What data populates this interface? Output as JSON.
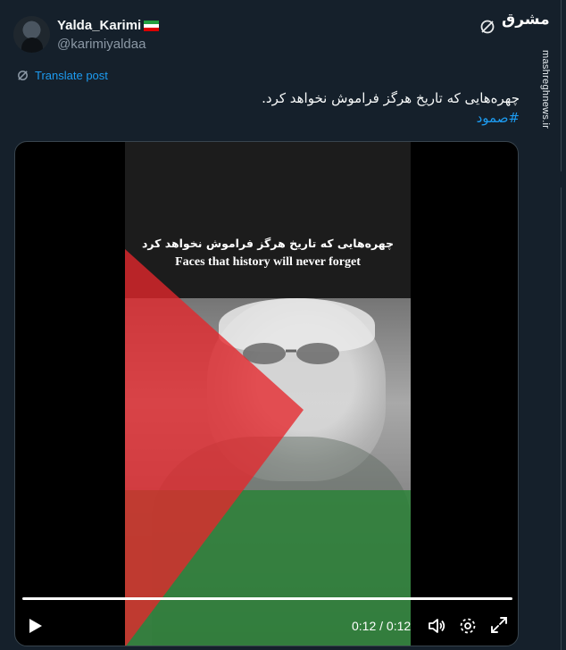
{
  "author": {
    "display_name": "Yalda_Karimi",
    "handle": "@karimiyaldaa",
    "flag_colors": [
      "#239f40",
      "#ffffff",
      "#da0000"
    ]
  },
  "header": {
    "grok_icon": "grok-icon",
    "watermark_logo": "مشرق",
    "watermark_url": "mashreghnews.ir"
  },
  "translate": {
    "label": "Translate post"
  },
  "tweet": {
    "text": "چهره‌هایی که تاریخ هرگز فراموش نخواهد کرد.",
    "hashtag": "#صمود"
  },
  "video": {
    "caption_fa": "چهره‌هایی که تاریخ هرگز فراموش نخواهد کرد",
    "caption_en": "Faces that history will never forget",
    "time": "0:12 / 0:12",
    "progress": 1.0,
    "controls": {
      "play": "play-icon",
      "volume": "volume-icon",
      "settings": "gear-icon",
      "fullscreen": "fullscreen-icon"
    }
  },
  "colors": {
    "background": "#15202b",
    "accent": "#1d9bf0",
    "muted": "#8b98a5",
    "flag_red": "#e5262b",
    "flag_green": "#368c42"
  }
}
